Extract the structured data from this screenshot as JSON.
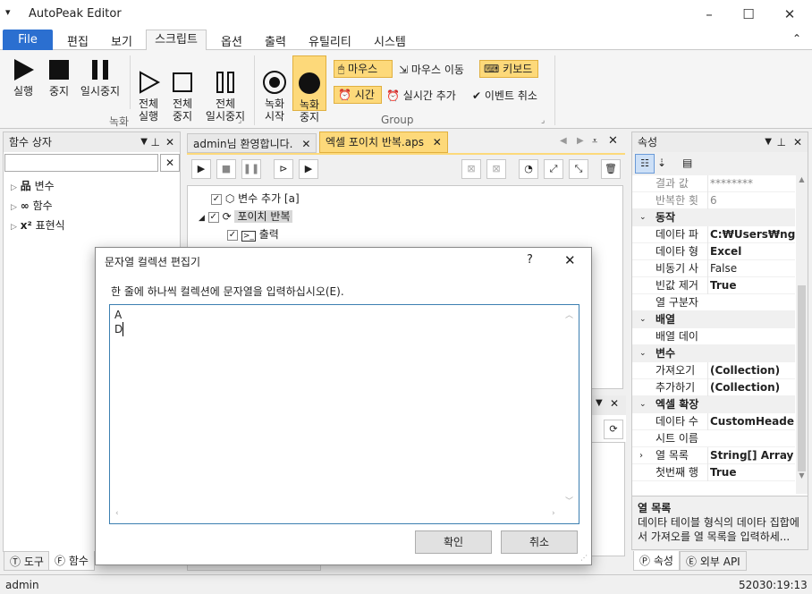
{
  "window": {
    "title": "AutoPeak Editor",
    "sys_icon": "▾",
    "minimize": "–",
    "maximize": "☐",
    "close": "✕"
  },
  "menu": {
    "file": "File",
    "items": [
      "편집",
      "보기",
      "스크립트",
      "옵션",
      "출력",
      "유틸리티",
      "시스템"
    ],
    "collapse": "⌃"
  },
  "ribbon": {
    "run": "실행",
    "stop": "중지",
    "pause": "일시중지",
    "run_all": "전체\n실행",
    "stop_all": "전체\n중지",
    "pause_all": "전체\n일시중지",
    "rec_start": "녹화\n시작",
    "rec_stop": "녹화\n중지",
    "mouse": "마우스",
    "mouse_move": "마우스 이동",
    "keyboard": "키보드",
    "time": "시간",
    "realtime_add": "실시간 추가",
    "event_cancel": "이벤트 취소",
    "group_record": "녹화",
    "group_group": "Group"
  },
  "left_panel": {
    "title": "함수 상자",
    "search_value": "",
    "items": [
      "변수",
      "함수",
      "표현식"
    ],
    "bottom_tabs": [
      "도구",
      "함수"
    ]
  },
  "editor": {
    "tabs": [
      "admin님 환영합니다.",
      "엑셀 포이치 반복.aps"
    ],
    "tree": [
      "변수 추가 [a]",
      "포이치 반복",
      "출력"
    ]
  },
  "right_panel": {
    "title": "속성",
    "rows": [
      {
        "k": "결과 값",
        "v": "********",
        "muted": true
      },
      {
        "k": "반복한 횟",
        "v": "6",
        "muted": true
      },
      {
        "section": "동작"
      },
      {
        "k": "데이타 파",
        "v": "C:₩Users₩ngma",
        "bold": true
      },
      {
        "k": "데이타 형",
        "v": "Excel",
        "bold": true
      },
      {
        "k": "비동기 사",
        "v": "False"
      },
      {
        "k": "빈값 제거",
        "v": "True",
        "bold": true
      },
      {
        "k": "열 구분자",
        "v": ""
      },
      {
        "section": "배열"
      },
      {
        "k": "배열 데이",
        "v": ""
      },
      {
        "section": "변수"
      },
      {
        "k": "가져오기",
        "v": "(Collection)",
        "bold": true
      },
      {
        "k": "추가하기",
        "v": "(Collection)",
        "bold": true
      },
      {
        "section": "엑셀 확장"
      },
      {
        "k": "데이타 수",
        "v": "CustomHeaderC",
        "bold": true
      },
      {
        "k": "시트 이름",
        "v": ""
      },
      {
        "k": "열 목록",
        "v": "String[] Array",
        "bold": true,
        "expand": true
      },
      {
        "k": "첫번째 행",
        "v": "True",
        "bold": true
      }
    ],
    "desc_title": "열 목록",
    "desc_text": "데이타 테이블 형식의 데이타 집합에서 가져오를 열 목록을 입력하세...",
    "bottom_tabs": [
      "속성",
      "외부 API"
    ]
  },
  "dialog": {
    "title": "문자열 컬렉션 편집기",
    "help": "?",
    "close": "✕",
    "instruction": "한 줄에 하나씩 컬렉션에 문자열을 입력하십시오(E).",
    "lines": [
      "A",
      "D"
    ],
    "ok": "확인",
    "cancel": "취소"
  },
  "status": {
    "user": "admin",
    "time": "52030:19:13"
  }
}
